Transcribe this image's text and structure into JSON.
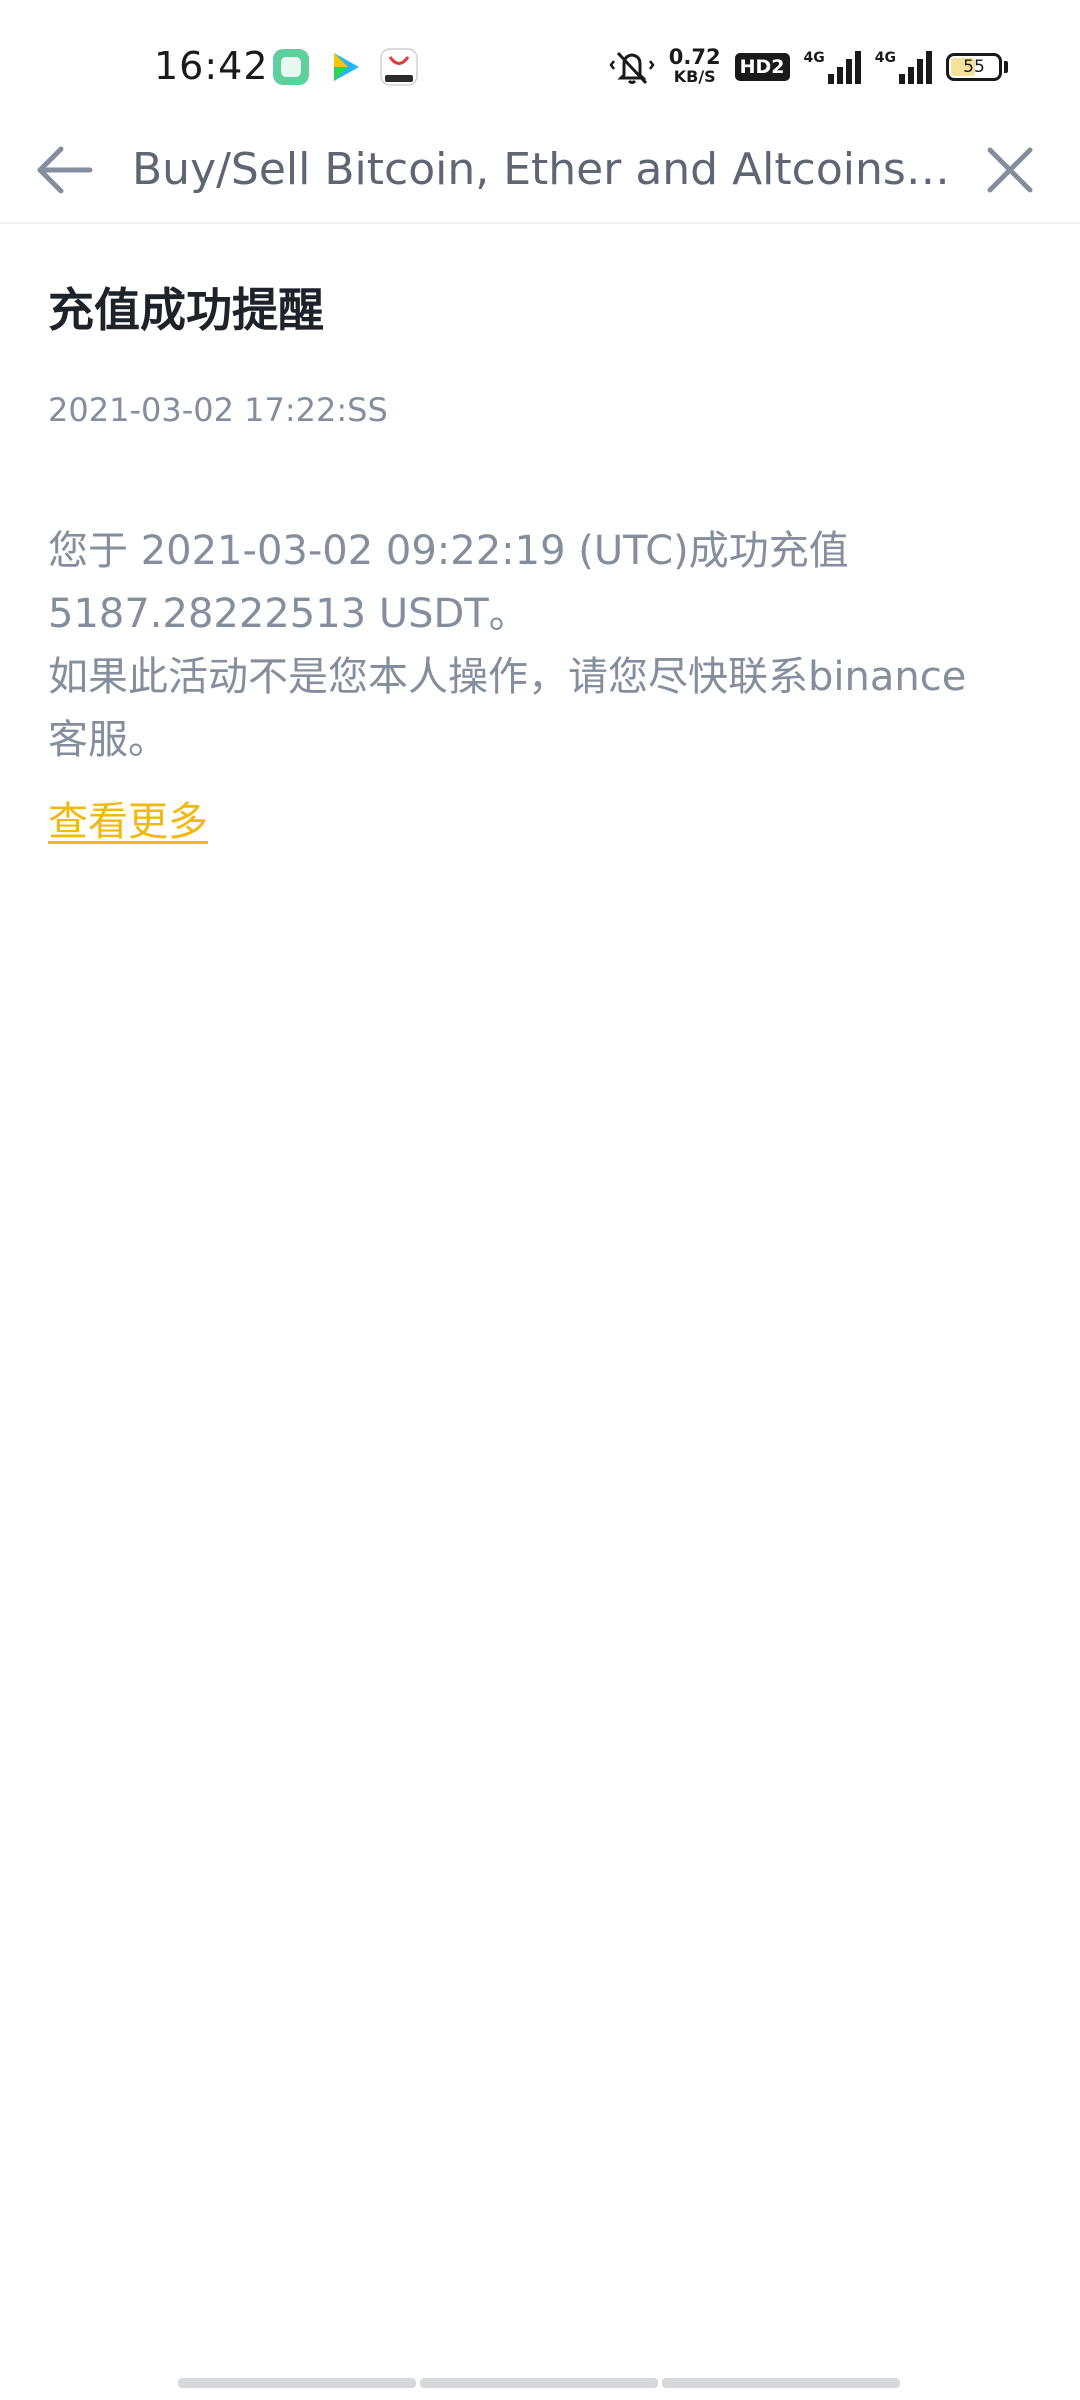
{
  "status_bar": {
    "time": "16:42",
    "notification_icons": [
      "app-green-square-icon",
      "video-play-icon",
      "app-cart-icon"
    ],
    "net_speed_value": "0.72",
    "net_speed_unit": "KB/S",
    "hd_label": "HD2",
    "signal_1_label": "4G",
    "signal_2_label": "4G",
    "battery_level": "55",
    "icons": [
      "mute-vibrate-icon",
      "signal-icon",
      "battery-icon"
    ]
  },
  "header": {
    "title": "Buy/Sell Bitcoin, Ether and Altcoins | C...",
    "back_icon": "back-arrow-icon",
    "close_icon": "close-icon"
  },
  "notice": {
    "title": "充值成功提醒",
    "time": "2021-03-02 17:22:SS",
    "body_lines": [
      "您于 2021-03-02 09:22:19 (UTC)成功充值",
      "5187.28222513 USDT。",
      "如果此活动不是您本人操作，请您尽快联系binance",
      "客服。"
    ],
    "more_link": "查看更多"
  },
  "colors": {
    "title_text": "#1e2329",
    "secondary_text": "#848e9c",
    "header_text": "#5e6673",
    "link": "#f0b90b",
    "battery_fill": "#f5e19a"
  }
}
